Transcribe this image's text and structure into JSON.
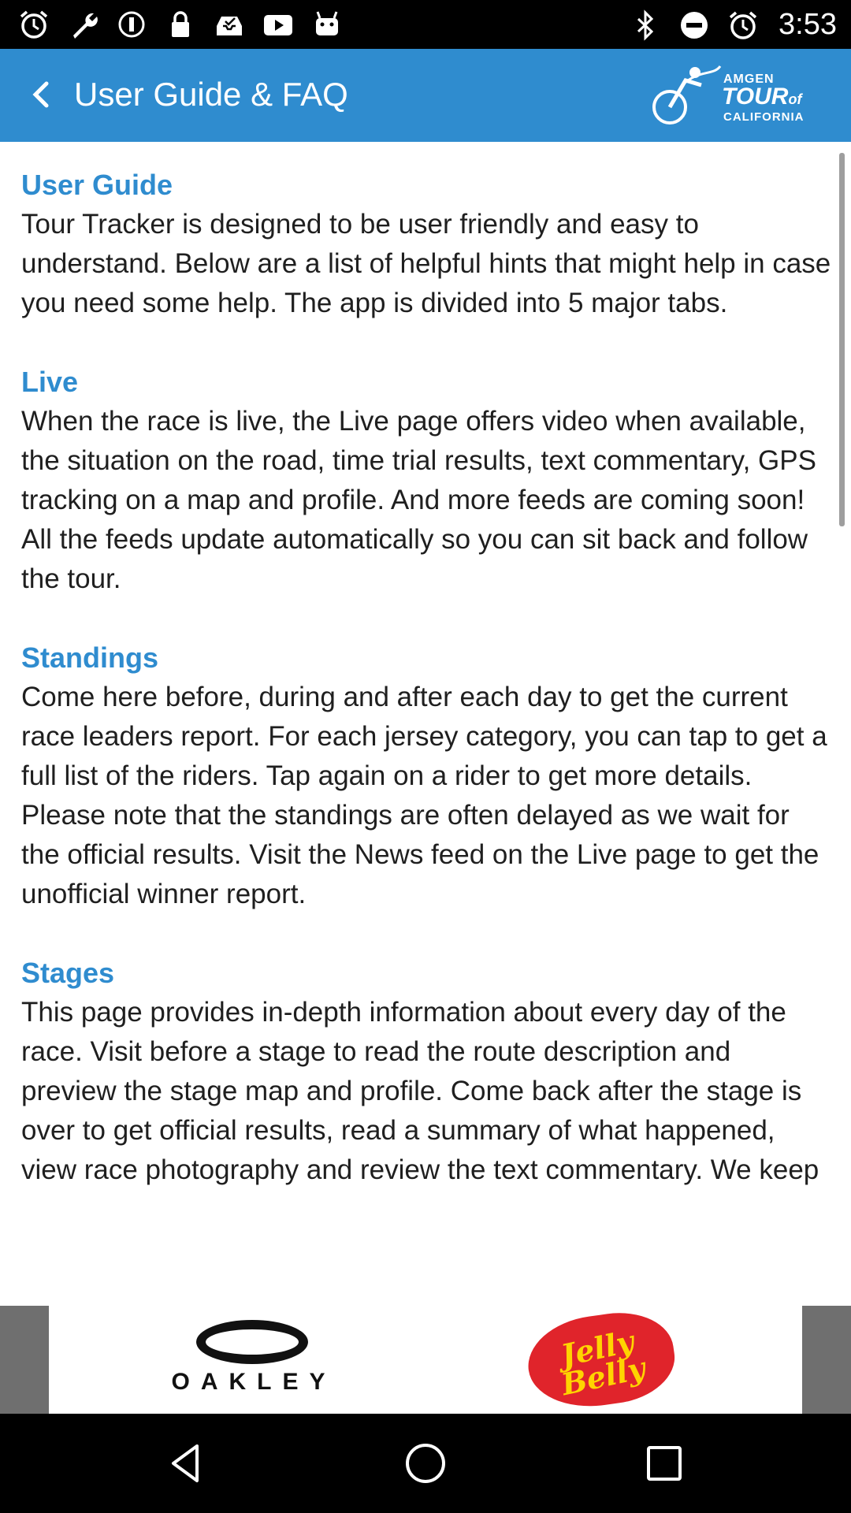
{
  "status_bar": {
    "time": "3:53",
    "left_icons": [
      "alarm-icon",
      "wrench-icon",
      "info-circle-icon",
      "lock-icon",
      "inbox-icon",
      "youtube-icon",
      "android-icon"
    ],
    "right_icons": [
      "bluetooth-icon",
      "do-not-disturb-icon",
      "alarm-icon"
    ]
  },
  "app_bar": {
    "title": "User Guide & FAQ",
    "logo": {
      "line1": "AMGEN",
      "line2": "TOUR",
      "line2_small": "of",
      "line3": "CALIFORNIA"
    }
  },
  "guide": {
    "sections": [
      {
        "heading": "User Guide",
        "body": "Tour Tracker is designed to be user friendly and easy to understand. Below are a list of helpful hints that might help in case you need some help. The app is divided into 5 major tabs."
      },
      {
        "heading": "Live",
        "body": "When the race is live, the Live page offers video when available, the situation on the road, time trial results, text commentary, GPS tracking on a map and profile. And more feeds are coming soon! All the feeds update automatically so you can sit back and follow the tour."
      },
      {
        "heading": "Standings",
        "body": "Come here before, during and after each day to get the current race leaders report. For each jersey category, you can tap to get a full list of the riders. Tap again on a rider to get more details. Please note that the standings are often delayed as we wait for the official results. Visit the News feed on the Live page to get the unofficial winner report."
      },
      {
        "heading": "Stages",
        "body": "This page provides in-depth information about every day of the race. Visit before a stage to read the route description and preview the stage map and profile. Come back after the stage is over to get official results, read a summary of what happened, view race photography and review the text commentary. We keep"
      }
    ]
  },
  "sponsors": {
    "oakley": "OAKLEY",
    "jelly_belly_line1": "Jelly",
    "jelly_belly_line2": "Belly"
  },
  "colors": {
    "accent": "#2f8ccf",
    "body_text": "#1f1f1f",
    "sponsor_gray": "#6f6f6f"
  }
}
